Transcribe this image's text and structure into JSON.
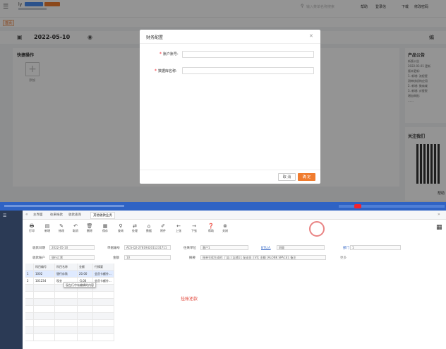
{
  "top_app": {
    "user_name": "ly",
    "user_badge_1": "",
    "user_badge_2": "",
    "user_sub": "",
    "nav_tag": "首页",
    "search_placeholder": "输入菜单名称搜索",
    "header_links": [
      "帮助",
      "登录信",
      "下载",
      "修改密码"
    ],
    "date": "2022-05-10",
    "right_label": "编",
    "quick_ops_title": "快捷操作",
    "quick_ops_add": "添加",
    "announcement": {
      "title": "产品公告",
      "lines": [
        "新版公告",
        "2022.03.01 更新",
        "版本更新:",
        "1. 新增: 流程提",
        "测审核机构应用",
        "2. 新增: 微商城",
        "3. 新增: 对接税",
        "增加审批:",
        "……"
      ]
    },
    "follow_us": "关注我们",
    "help_text": "帮助"
  },
  "dialog": {
    "title": "财务配置",
    "close_icon": "close-icon",
    "fields": [
      {
        "label": "账户账号:",
        "required": true,
        "value": "",
        "placeholder": ""
      },
      {
        "label": "数据库名称:",
        "required": true,
        "value": "",
        "placeholder": ""
      }
    ],
    "cancel_label": "取 消",
    "ok_label": "确 定",
    "accent": "#f07c2f"
  },
  "bottom_app": {
    "top_title": "",
    "top_right": "",
    "tabs": [
      "主界面",
      "往来帐款",
      "收款查询",
      "其他收款业务"
    ],
    "active_tab": 3,
    "tools": [
      {
        "icon": "print-icon",
        "label": "打印"
      },
      {
        "icon": "new-icon",
        "label": "新增"
      },
      {
        "icon": "edit-icon",
        "label": "修改"
      },
      {
        "icon": "undo-icon",
        "label": "取消"
      },
      {
        "icon": "delete-icon",
        "label": "删除"
      },
      {
        "icon": "save-icon",
        "label": "保存"
      },
      {
        "icon": "query-icon",
        "label": "查询"
      },
      {
        "icon": "dispose-icon",
        "label": "处理"
      },
      {
        "icon": "data-icon",
        "label": "数据"
      },
      {
        "icon": "attach-icon",
        "label": "附件"
      },
      {
        "icon": "prev-icon",
        "label": "上张"
      },
      {
        "icon": "next-icon",
        "label": "下张"
      },
      {
        "icon": "help-icon",
        "label": "帮助"
      },
      {
        "icon": "close-icon",
        "label": "关闭"
      }
    ],
    "form": {
      "date_label": "收款日期",
      "date_value": "2022-05-10",
      "bill_label": "单据编号",
      "bill_value": "ACS-Q2-2781942011231711",
      "unit_label": "往来单位",
      "unit_value": "客户1",
      "link_label": "BTU人",
      "link_value": "测量",
      "dept_label": "部门",
      "dept_value": "1",
      "account_label": "收款账户",
      "account_value": "银行汇票",
      "amount_label": "金额",
      "amount_value": "10",
      "summary_label": "摘要",
      "summary_value": "账单号续生成的: 门店: [店铺1]; 配送员: [VI]; 金额 [ALONK SPACE]; 备注",
      "more_label": "更多"
    },
    "table": {
      "headers": [
        "",
        "科目编号",
        "科目名称",
        "金额",
        "行摘要"
      ],
      "rows": [
        [
          "1",
          "1002",
          "银行存款",
          "20.00",
          "会员卡额外..."
        ],
        [
          "2",
          "101234",
          "现金",
          "-5.00",
          "会员卡额外..."
        ]
      ],
      "tooltip": "现在行中有编辑的内容"
    },
    "center_hint": "挂账还款",
    "accent_blue": "#2f63c4"
  }
}
